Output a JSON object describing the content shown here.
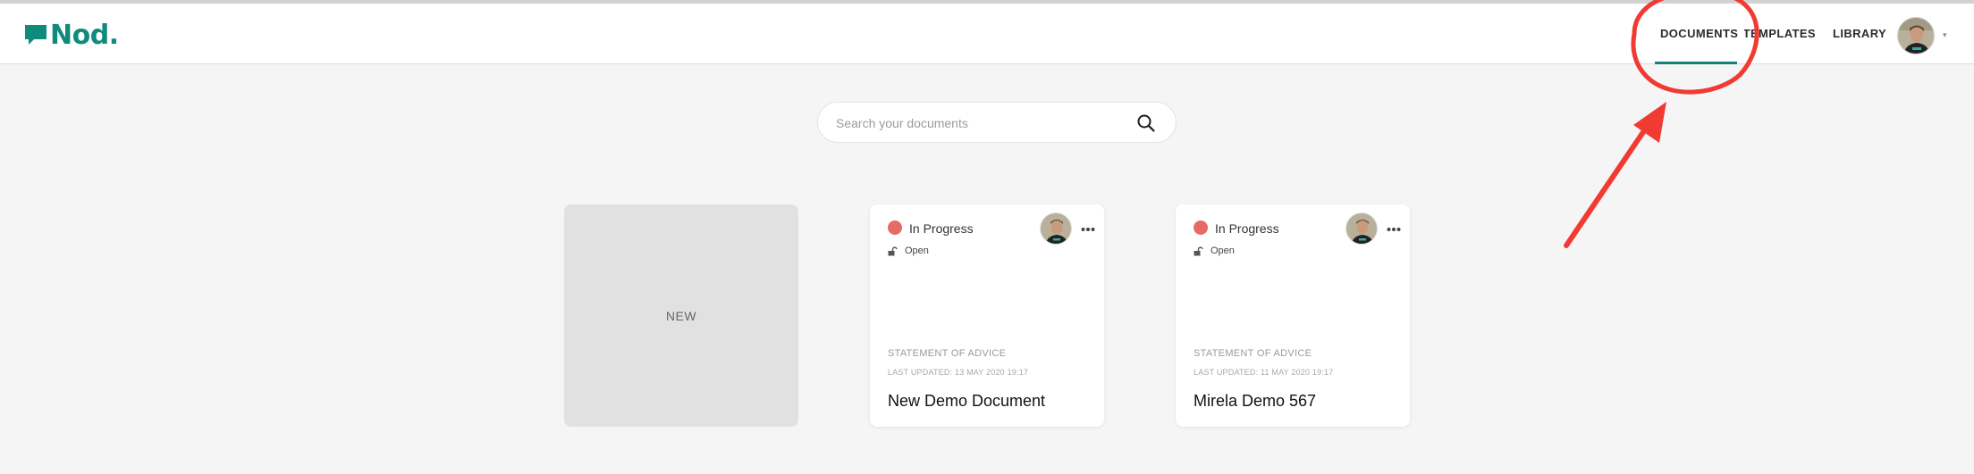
{
  "header": {
    "logo_text": "Nod.",
    "brand_color": "#0f8b7d",
    "nav": [
      {
        "label": "DOCUMENTS",
        "active": true
      },
      {
        "label": "TEMPLATES",
        "visible_text": "EMPLATES"
      },
      {
        "label": "LIBRARY"
      }
    ],
    "avatar": "user-avatar",
    "caret_icon": "caret-down-icon"
  },
  "search": {
    "placeholder": "Search your documents",
    "value": "",
    "icon": "search-icon"
  },
  "new_card": {
    "label": "NEW"
  },
  "documents": [
    {
      "status": "In Progress",
      "status_color": "#e86a66",
      "access": "Open",
      "type": "STATEMENT OF ADVICE",
      "updated": "LAST UPDATED: 13 MAY 2020 19:17",
      "title": "New Demo Document"
    },
    {
      "status": "In Progress",
      "status_color": "#e86a66",
      "access": "Open",
      "type": "STATEMENT OF ADVICE",
      "updated": "LAST UPDATED: 11 MAY 2020 19:17",
      "title": "Mirela Demo 567"
    }
  ],
  "annotation": {
    "color": "#f03a32",
    "shapes": [
      "highlight-circle",
      "pointer-arrow"
    ]
  }
}
